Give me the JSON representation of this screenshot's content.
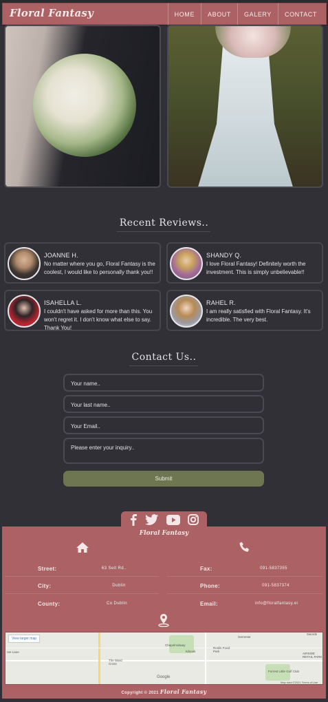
{
  "nav": {
    "logo": "Floral Fantasy",
    "items": [
      "HOME",
      "ABOUT",
      "GALERY",
      "CONTACT"
    ]
  },
  "reviews": {
    "title": "Recent Reviews..",
    "items": [
      {
        "name": "JOANNE H.",
        "text": "No matter where you go, Floral Fantasy is the coolest, I would like to personally thank you!!"
      },
      {
        "name": "SHANDY Q.",
        "text": "I love Floral Fantasy! Definitely worth the investment. This is simply unbelievable!!"
      },
      {
        "name": "ISAHELLA L.",
        "text": "I couldn't have asked for more than this. You won't regret it. I don't know what else to say. Thank You!"
      },
      {
        "name": "RAHEL R.",
        "text": "I am really satisfied with Floral Fantasy. It's incredible. The very best."
      }
    ]
  },
  "contact": {
    "title": "Contact Us..",
    "name_placeholder": "Your name..",
    "last_name_placeholder": "Your last name..",
    "email_placeholder": "Your Email..",
    "inquiry_placeholder": "Please enter your inquiry..",
    "submit_label": "Submit"
  },
  "footer": {
    "logo": "Floral Fantasy",
    "street_label": "Street:",
    "street_value": "63 Selt Rd..",
    "city_label": "City:",
    "city_value": "Dublin",
    "county_label": "County:",
    "county_value": "Co Dublin",
    "fax_label": "Fax:",
    "fax_value": "091-5837355",
    "phone_label": "Phone:",
    "phone_value": "091-5837374",
    "email_label": "Email:",
    "email_value": "info@floralfantasy.ei",
    "map": {
      "larger_map": "View larger map",
      "place1": "Chapelmidway",
      "place2": "Kilsook",
      "place3": "Roslin Food Park",
      "place4": "The Ward Cross",
      "place5": "Forrest Little Golf Club",
      "place6": "AIRSIDE RETAIL PARK",
      "place7": "Swords",
      "place8": "Gerneste",
      "place9": "ree Lane",
      "google": "Google",
      "attribution": "Map data ©2021   Terms of Use"
    },
    "copyright_prefix": "Copyright © 2021",
    "copyright_brand": "Floral Fantasy"
  },
  "colors": {
    "background": "#303036",
    "accent": "#ac6264",
    "submit": "#6e7551"
  }
}
